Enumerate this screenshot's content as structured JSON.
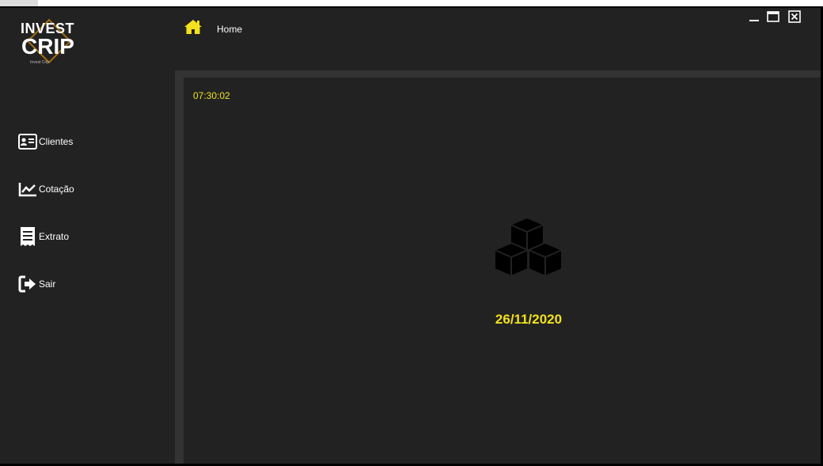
{
  "brand": {
    "line1": "INVEST",
    "line2": "CRIP",
    "tagline": "Invest Crip",
    "accent": "#a66f12"
  },
  "nav": {
    "items": [
      {
        "label": "Clientes",
        "icon": "id-card-icon"
      },
      {
        "label": "Cotação",
        "icon": "chart-line-icon"
      },
      {
        "label": "Extrato",
        "icon": "receipt-icon"
      },
      {
        "label": "Sair",
        "icon": "sign-out-icon"
      }
    ]
  },
  "header": {
    "home_icon": "home-icon",
    "breadcrumb": "Home"
  },
  "window_controls": {
    "minimize": "minimize-icon",
    "maximize": "maximize-icon",
    "close": "close-icon"
  },
  "main": {
    "time": "07:30:02",
    "date": "26/11/2020",
    "center_icon": "cubes-icon"
  },
  "colors": {
    "background": "#222222",
    "frame": "#333333",
    "highlight": "#f2e11c",
    "text": "#ffffff"
  }
}
